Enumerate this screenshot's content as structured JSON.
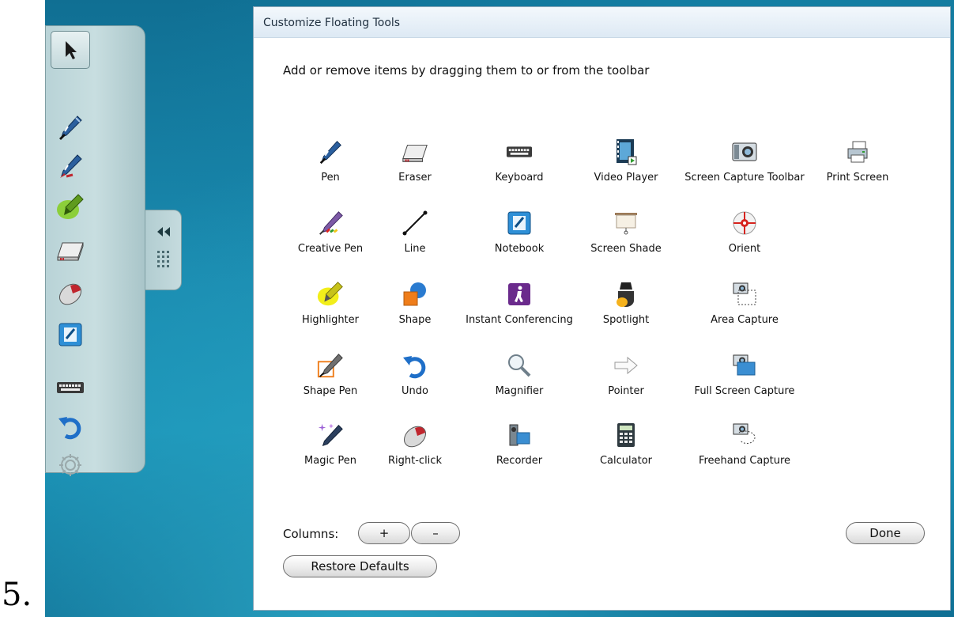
{
  "step_number": "5.",
  "floating_toolbar": {
    "tools": [
      {
        "name": "select-arrow-icon"
      },
      {
        "name": "pen-icon"
      },
      {
        "name": "creative-pen-icon"
      },
      {
        "name": "highlighter-icon"
      },
      {
        "name": "eraser-icon"
      },
      {
        "name": "right-click-icon"
      },
      {
        "name": "notebook-icon"
      },
      {
        "name": "keyboard-icon"
      },
      {
        "name": "undo-icon"
      },
      {
        "name": "settings-gear-icon"
      }
    ],
    "collapse_icon": "double-chevron-left-icon",
    "grip_icon": "grip-dots-icon"
  },
  "dialog": {
    "title": "Customize Floating Tools",
    "instructions": "Add or remove items by dragging them to or from the toolbar",
    "items": [
      {
        "label": "Pen",
        "icon": "pen-icon"
      },
      {
        "label": "Eraser",
        "icon": "eraser-icon"
      },
      {
        "label": "Keyboard",
        "icon": "keyboard-icon"
      },
      {
        "label": "Video Player",
        "icon": "video-player-icon"
      },
      {
        "label": "Screen Capture Toolbar",
        "icon": "camera-icon"
      },
      {
        "label": "Print Screen",
        "icon": "printer-icon"
      },
      {
        "label": "Creative Pen",
        "icon": "creative-pen-icon"
      },
      {
        "label": "Line",
        "icon": "line-icon"
      },
      {
        "label": "Notebook",
        "icon": "notebook-icon"
      },
      {
        "label": "Screen Shade",
        "icon": "screen-shade-icon"
      },
      {
        "label": "Orient",
        "icon": "orient-target-icon"
      },
      {
        "label": "Highlighter",
        "icon": "highlighter-icon"
      },
      {
        "label": "Shape",
        "icon": "shape-icon"
      },
      {
        "label": "Instant Conferencing",
        "icon": "conferencing-icon"
      },
      {
        "label": "Spotlight",
        "icon": "spotlight-icon"
      },
      {
        "label": "Area Capture",
        "icon": "area-capture-icon"
      },
      {
        "label": "Shape Pen",
        "icon": "shape-pen-icon"
      },
      {
        "label": "Undo",
        "icon": "undo-icon"
      },
      {
        "label": "Magnifier",
        "icon": "magnifier-icon"
      },
      {
        "label": "Pointer",
        "icon": "pointer-arrow-icon"
      },
      {
        "label": "Full Screen Capture",
        "icon": "full-screen-capture-icon"
      },
      {
        "label": "Magic Pen",
        "icon": "magic-pen-icon"
      },
      {
        "label": "Right-click",
        "icon": "right-click-icon"
      },
      {
        "label": "Recorder",
        "icon": "recorder-icon"
      },
      {
        "label": "Calculator",
        "icon": "calculator-icon"
      },
      {
        "label": "Freehand Capture",
        "icon": "freehand-capture-icon"
      }
    ],
    "columns_label": "Columns:",
    "plus_label": "+",
    "minus_label": "–",
    "done_label": "Done",
    "restore_label": "Restore Defaults"
  },
  "colors": {
    "desktop": "#1a8bb0",
    "toolbar": "#c3dadd",
    "dialog_border": "#8ca7b8",
    "pen_blue": "#1f5fae",
    "highlighter_green": "#8ccf3a",
    "highlighter_yellow": "#f2ee1a",
    "notebook_blue": "#2e8fd6",
    "conferencing_purple": "#6a2a8c",
    "shape_orange": "#ef7d1a"
  }
}
